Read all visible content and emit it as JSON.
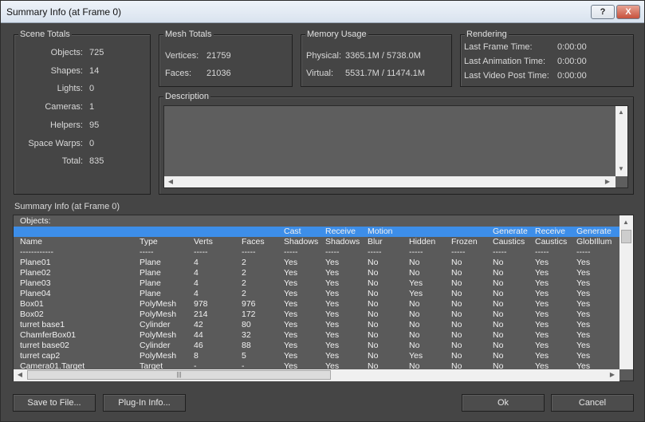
{
  "window": {
    "title": "Summary Info (at Frame 0)",
    "help_button": "?",
    "close_button": "X"
  },
  "scene_totals": {
    "label": "Scene Totals",
    "items": [
      {
        "label": "Objects:",
        "value": "725"
      },
      {
        "label": "Shapes:",
        "value": "14"
      },
      {
        "label": "Lights:",
        "value": "0"
      },
      {
        "label": "Cameras:",
        "value": "1"
      },
      {
        "label": "Helpers:",
        "value": "95"
      },
      {
        "label": "Space Warps:",
        "value": "0"
      },
      {
        "label": "Total:",
        "value": "835"
      }
    ]
  },
  "mesh_totals": {
    "label": "Mesh Totals",
    "vertices_label": "Vertices:",
    "vertices": "21759",
    "faces_label": "Faces:",
    "faces": "21036"
  },
  "memory_usage": {
    "label": "Memory Usage",
    "physical_label": "Physical:",
    "physical": "3365.1M / 5738.0M",
    "virtual_label": "Virtual:",
    "virtual": "5531.7M / 11474.1M"
  },
  "rendering": {
    "label": "Rendering",
    "items": [
      {
        "label": "Last Frame Time:",
        "value": "0:00:00"
      },
      {
        "label": "Last Animation Time:",
        "value": "0:00:00"
      },
      {
        "label": "Last Video Post Time:",
        "value": "0:00:00"
      }
    ]
  },
  "description": {
    "label": "Description"
  },
  "summary": {
    "label": "Summary Info (at Frame 0)",
    "objects_header": "Objects:",
    "header_top": [
      "",
      "",
      "",
      "",
      "Cast",
      "Receive",
      "Motion",
      "",
      "",
      "Generate",
      "Receive",
      "Generate"
    ],
    "header_bottom": [
      "Name",
      "Type",
      "Verts",
      "Faces",
      "Shadows",
      "Shadows",
      "Blur",
      "Hidden",
      "Frozen",
      "Caustics",
      "Caustics",
      "GlobIllum"
    ],
    "separator": [
      "------------",
      "-----",
      "-----",
      "-----",
      "-----",
      "-----",
      "-----",
      "-----",
      "-----",
      "-----",
      "-----",
      "-----"
    ],
    "rows": [
      [
        "Plane01",
        "Plane",
        "4",
        "2",
        "Yes",
        "Yes",
        "No",
        "No",
        "No",
        "No",
        "Yes",
        "Yes"
      ],
      [
        "Plane02",
        "Plane",
        "4",
        "2",
        "Yes",
        "Yes",
        "No",
        "No",
        "No",
        "No",
        "Yes",
        "Yes"
      ],
      [
        "Plane03",
        "Plane",
        "4",
        "2",
        "Yes",
        "Yes",
        "No",
        "Yes",
        "No",
        "No",
        "Yes",
        "Yes"
      ],
      [
        "Plane04",
        "Plane",
        "4",
        "2",
        "Yes",
        "Yes",
        "No",
        "Yes",
        "No",
        "No",
        "Yes",
        "Yes"
      ],
      [
        "Box01",
        "PolyMesh",
        "978",
        "976",
        "Yes",
        "Yes",
        "No",
        "No",
        "No",
        "No",
        "Yes",
        "Yes"
      ],
      [
        "Box02",
        "PolyMesh",
        "214",
        "172",
        "Yes",
        "Yes",
        "No",
        "No",
        "No",
        "No",
        "Yes",
        "Yes"
      ],
      [
        "turret base1",
        "Cylinder",
        "42",
        "80",
        "Yes",
        "Yes",
        "No",
        "No",
        "No",
        "No",
        "Yes",
        "Yes"
      ],
      [
        "ChamferBox01",
        "PolyMesh",
        "44",
        "32",
        "Yes",
        "Yes",
        "No",
        "No",
        "No",
        "No",
        "Yes",
        "Yes"
      ],
      [
        "turret base02",
        "Cylinder",
        "46",
        "88",
        "Yes",
        "Yes",
        "No",
        "No",
        "No",
        "No",
        "Yes",
        "Yes"
      ],
      [
        "turret cap2",
        "PolyMesh",
        "8",
        "5",
        "Yes",
        "Yes",
        "No",
        "Yes",
        "No",
        "No",
        "Yes",
        "Yes"
      ],
      [
        "Camera01.Target",
        "Target",
        "-",
        "-",
        "Yes",
        "Yes",
        "No",
        "No",
        "No",
        "No",
        "Yes",
        "Yes"
      ]
    ],
    "hscroll_grip": "|||"
  },
  "buttons": {
    "save": "Save to File...",
    "plugin": "Plug-In Info...",
    "ok": "Ok",
    "cancel": "Cancel"
  }
}
